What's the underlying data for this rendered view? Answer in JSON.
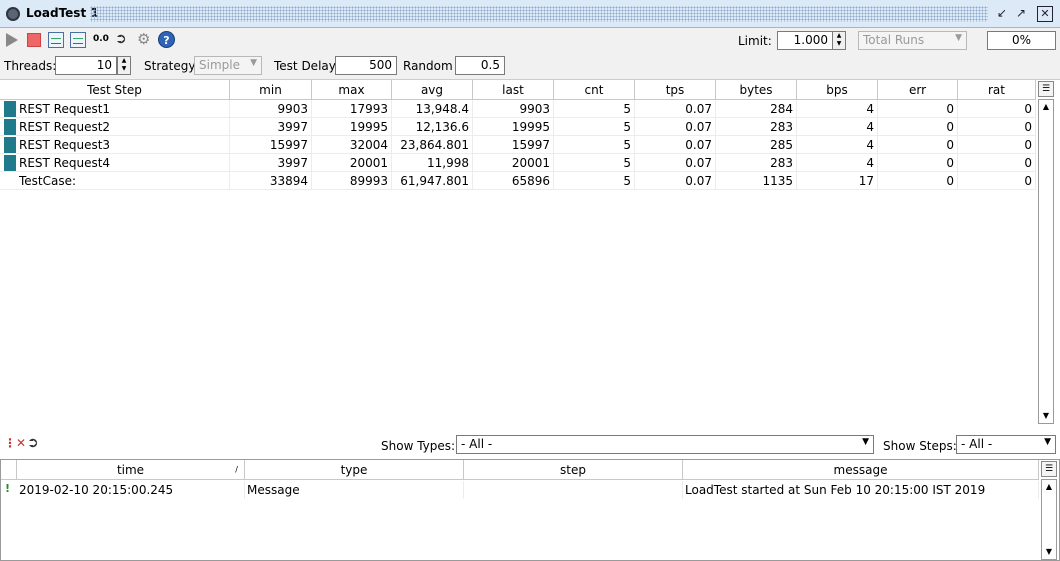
{
  "window": {
    "title": "LoadTest 1"
  },
  "toolbar": {
    "zero_label": "0.0",
    "limit_label": "Limit:",
    "limit_value": "1.000",
    "limit_type": "Total Runs",
    "progress": "0%"
  },
  "params": {
    "threads_label": "Threads:",
    "threads_value": "10",
    "strategy_label": "Strategy",
    "strategy_value": "Simple",
    "delay_label": "Test Delay",
    "delay_value": "500",
    "random_label": "Random",
    "random_value": "0.5"
  },
  "grid": {
    "headers": [
      "Test Step",
      "min",
      "max",
      "avg",
      "last",
      "cnt",
      "tps",
      "bytes",
      "bps",
      "err",
      "rat"
    ],
    "rows": [
      {
        "name": "REST Request1",
        "min": "9903",
        "max": "17993",
        "avg": "13,948.4",
        "last": "9903",
        "cnt": "5",
        "tps": "0.07",
        "bytes": "284",
        "bps": "4",
        "err": "0",
        "rat": "0"
      },
      {
        "name": "REST Request2",
        "min": "3997",
        "max": "19995",
        "avg": "12,136.6",
        "last": "19995",
        "cnt": "5",
        "tps": "0.07",
        "bytes": "283",
        "bps": "4",
        "err": "0",
        "rat": "0"
      },
      {
        "name": "REST Request3",
        "min": "15997",
        "max": "32004",
        "avg": "23,864.801",
        "last": "15997",
        "cnt": "5",
        "tps": "0.07",
        "bytes": "285",
        "bps": "4",
        "err": "0",
        "rat": "0"
      },
      {
        "name": "REST Request4",
        "min": "3997",
        "max": "20001",
        "avg": "11,998",
        "last": "20001",
        "cnt": "5",
        "tps": "0.07",
        "bytes": "283",
        "bps": "4",
        "err": "0",
        "rat": "0"
      },
      {
        "name": "TestCase:",
        "min": "33894",
        "max": "89993",
        "avg": "61,947.801",
        "last": "65896",
        "cnt": "5",
        "tps": "0.07",
        "bytes": "1135",
        "bps": "17",
        "err": "0",
        "rat": "0"
      }
    ]
  },
  "log": {
    "show_types_label": "Show Types:",
    "show_types_value": "- All -",
    "show_steps_label": "Show Steps:",
    "show_steps_value": "- All -",
    "headers": [
      "time",
      "type",
      "step",
      "message"
    ],
    "sort_indicator": "/",
    "entries": [
      {
        "time": "2019-02-10 20:15:00.245",
        "type": "Message",
        "step": "",
        "message": "LoadTest started at Sun Feb 10 20:15:00 IST 2019"
      }
    ]
  },
  "colors": {
    "titlebar": "#dce9f7",
    "step_marker": "#1f7a8c",
    "stop": "#ef6666",
    "help": "#2e63b8"
  },
  "icons": [
    "circle-window-icon",
    "minimize-icon",
    "restore-icon",
    "close-icon",
    "play-icon",
    "stop-icon",
    "graph-icon",
    "statistics-icon",
    "reset-icon",
    "export-icon",
    "options-icon",
    "help-icon",
    "clear-log-icon",
    "export-log-icon",
    "column-config-icon",
    "scroll-up-icon",
    "scroll-down-icon",
    "info-icon"
  ]
}
